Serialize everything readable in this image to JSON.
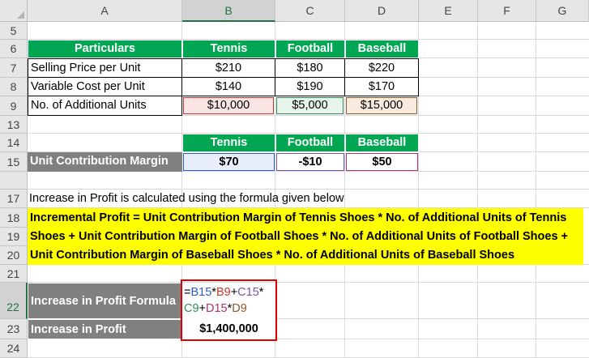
{
  "columns": [
    "A",
    "B",
    "C",
    "D",
    "E",
    "F",
    "G"
  ],
  "selected_column": "B",
  "rows": [
    "5",
    "6",
    "7",
    "8",
    "9",
    "13",
    "14",
    "15",
    "17",
    "18",
    "19",
    "20",
    "21",
    "22",
    "23",
    "24"
  ],
  "selected_row": "22",
  "table1": {
    "header": [
      "Particulars",
      "Tennis",
      "Football",
      "Baseball"
    ],
    "rows": [
      [
        "Selling Price per Unit",
        "$210",
        "$180",
        "$220"
      ],
      [
        "Variable Cost per Unit",
        "$140",
        "$190",
        "$170"
      ],
      [
        "No. of Additional Units",
        "$10,000",
        "$5,000",
        "$15,000"
      ]
    ]
  },
  "table2": {
    "header": [
      "Tennis",
      "Football",
      "Baseball"
    ],
    "label": "Unit Contribution Margin",
    "values": [
      "$70",
      "-$10",
      "$50"
    ]
  },
  "note": "Increase in Profit is calculated using the formula given below",
  "formula_text": [
    "Incremental Profit = Unit Contribution Margin of Tennis Shoes * No. of Additional Units of Tennis",
    "Shoes + Unit Contribution Margin of Football Shoes * No. of Additional Units of Football Shoes +",
    "Unit Contribution Margin of Baseball Shoes * No. of Additional Units of Baseball Shoes"
  ],
  "profit_formula": {
    "label": "Increase in Profit Formula",
    "line1": [
      "=",
      "B15",
      "*",
      "B9",
      "+",
      "C15",
      "*"
    ],
    "line2": [
      "C9",
      "+",
      "D15",
      "*",
      "D9"
    ]
  },
  "profit_result": {
    "label": "Increase in Profit",
    "value": "$1,400,000"
  },
  "colors": {
    "header_green": "#00a651",
    "label_gray": "#808080",
    "highlight_yellow": "#ffff00",
    "ref_blue": "#2b5ecb",
    "ref_red": "#c0392b",
    "ref_purple": "#7b52ab",
    "ref_green": "#2e8b57",
    "ref_pink": "#b0306b",
    "ref_brown": "#8b5a2b",
    "selection_red": "#e00000"
  }
}
